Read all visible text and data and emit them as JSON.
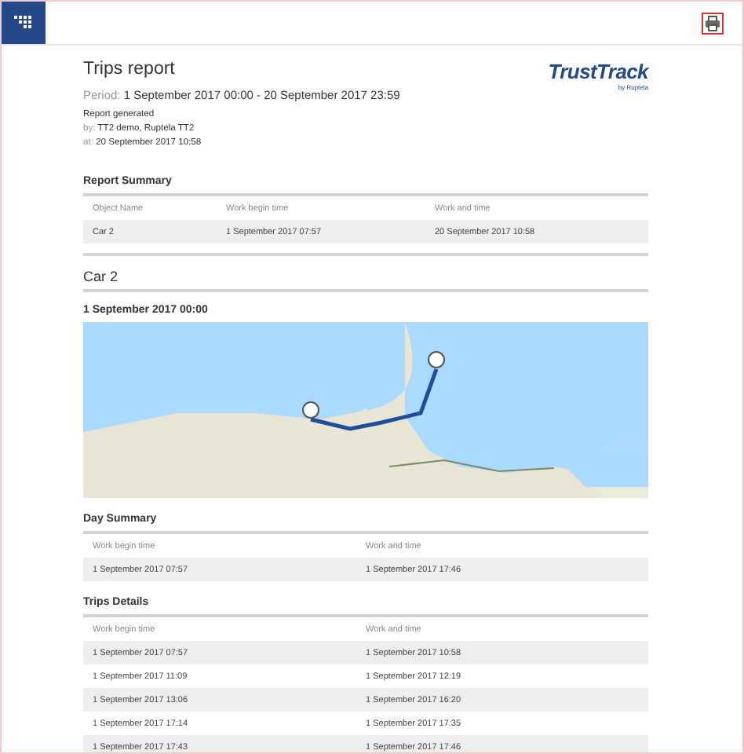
{
  "report": {
    "title": "Trips report",
    "period_label": "Period:",
    "period": "1 September 2017 00:00 - 20 September 2017 23:59",
    "generated": "Report generated",
    "by_label": "by:",
    "by": "TT2 demo, Ruptela TT2",
    "at_label": "at:",
    "at": "20 September 2017 10:58"
  },
  "brand": {
    "name": "TrustTrack",
    "tagline": "by Ruptela"
  },
  "summary": {
    "title": "Report Summary",
    "columns": [
      "Object Name",
      "Work begin time",
      "Work and time"
    ],
    "rows": [
      [
        "Car 2",
        "1 September 2017 07:57",
        "20 September 2017 10:58"
      ]
    ]
  },
  "object": {
    "title": "Car 2",
    "date": "1 September 2017 00:00"
  },
  "day_summary": {
    "title": "Day Summary",
    "columns": [
      "Work begin time",
      "Work and time"
    ],
    "rows": [
      [
        "1 September 2017 07:57",
        "1 September 2017 17:46"
      ]
    ]
  },
  "trips": {
    "title": "Trips Details",
    "columns": [
      "Work begin time",
      "Work and time"
    ],
    "rows": [
      [
        "1 September 2017 07:57",
        "1 September 2017 10:58"
      ],
      [
        "1 September 2017 11:09",
        "1 September 2017 12:19"
      ],
      [
        "1 September 2017 13:06",
        "1 September 2017 16:20"
      ],
      [
        "1 September 2017 17:14",
        "1 September 2017 17:35"
      ],
      [
        "1 September 2017 17:43",
        "1 September 2017 17:46"
      ]
    ]
  }
}
